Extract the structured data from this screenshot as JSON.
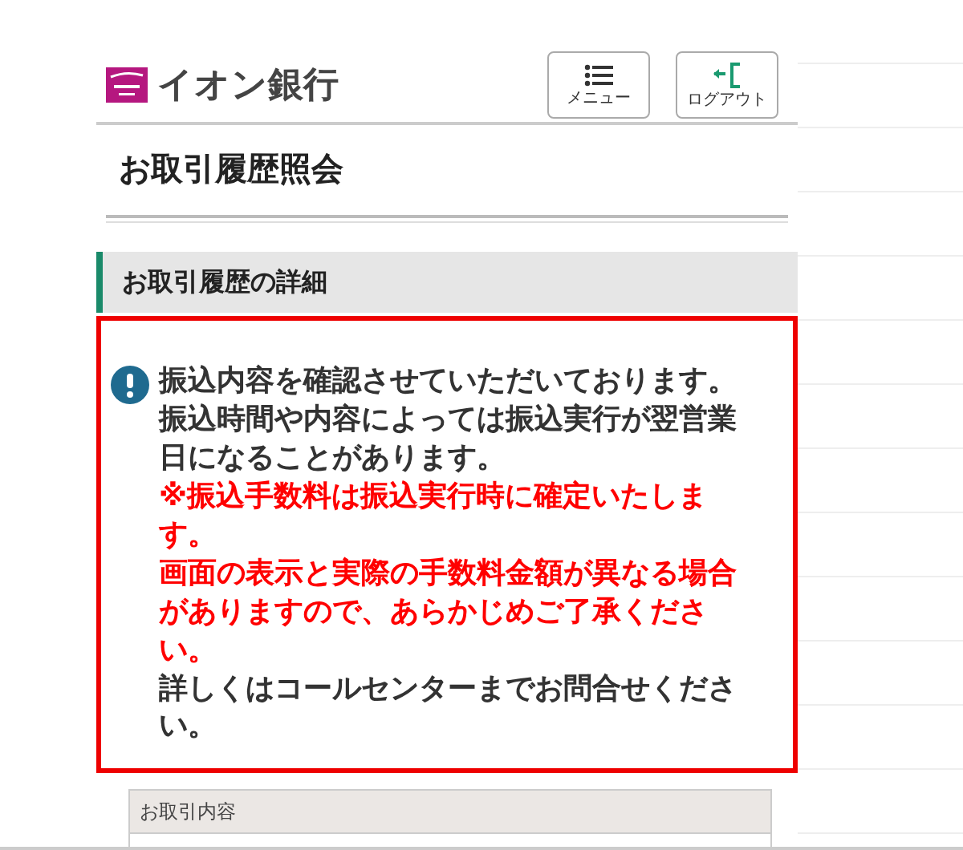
{
  "header": {
    "logo_text": "イオン銀行",
    "buttons": [
      {
        "kind": "menu",
        "label": "メニュー"
      },
      {
        "kind": "logout",
        "label": "ログアウト"
      }
    ]
  },
  "page_title": "お取引履歴照会",
  "section_heading": "お取引履歴の詳細",
  "notice": {
    "paragraphs": [
      {
        "kind": "normal",
        "text": "振込内容を確認させていただいております。"
      },
      {
        "kind": "normal",
        "text": "振込時間や内容によっては振込実行が翌営業日になることがあります。"
      },
      {
        "kind": "warning",
        "text": "※振込手数料は振込実行時に確定いたします。"
      },
      {
        "kind": "warning",
        "text": "画面の表示と実際の手数料金額が異なる場合がありますので、あらかじめご了承ください。"
      },
      {
        "kind": "normal",
        "text": "詳しくはコールセンターまでお問合せください。"
      }
    ]
  },
  "table": {
    "header": "お取引内容"
  }
}
